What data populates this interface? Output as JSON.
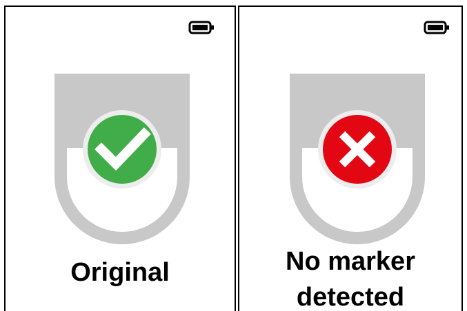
{
  "panels": [
    {
      "status_icon": "checkmark-icon",
      "status_color": "#41ad49",
      "caption": "Original"
    },
    {
      "status_icon": "cross-icon",
      "status_color": "#e30613",
      "caption_line1": "No marker",
      "caption_line2": "detected"
    }
  ],
  "colors": {
    "tag_gray": "#c8c8c8",
    "tag_light": "#ededed",
    "frame": "#000000"
  },
  "icons": {
    "battery": "battery-full-icon"
  }
}
